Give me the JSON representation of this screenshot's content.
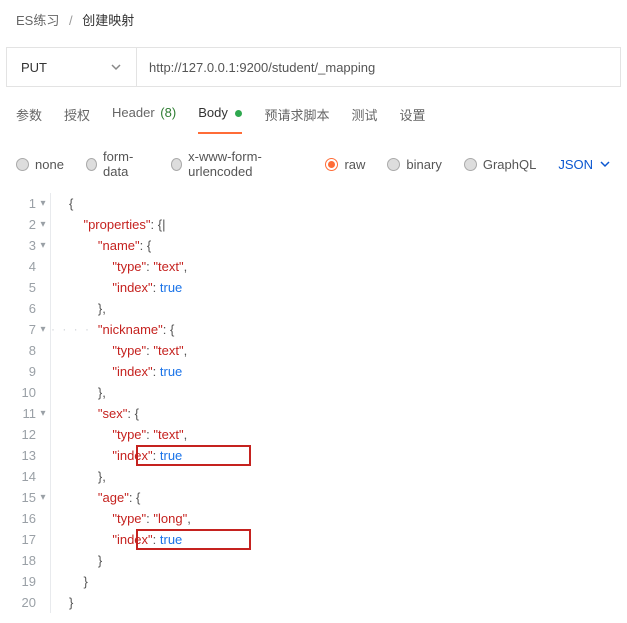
{
  "breadcrumb": {
    "root": "ES练习",
    "current": "创建映射"
  },
  "request": {
    "method": "PUT",
    "url": "http://127.0.0.1:9200/student/_mapping"
  },
  "tabs": {
    "params": "参数",
    "auth": "授权",
    "headers_label": "Header",
    "headers_count": "(8)",
    "body": "Body",
    "prescript": "预请求脚本",
    "tests": "测试",
    "settings": "设置"
  },
  "body_types": {
    "none": "none",
    "formdata": "form-data",
    "xform": "x-www-form-urlencoded",
    "raw": "raw",
    "binary": "binary",
    "graphql": "GraphQL",
    "format": "JSON"
  },
  "code": {
    "line1": "{",
    "k_properties": "\"properties\"",
    "k_name": "\"name\"",
    "k_nickname": "\"nickname\"",
    "k_sex": "\"sex\"",
    "k_age": "\"age\"",
    "k_type": "\"type\"",
    "k_index": "\"index\"",
    "v_text": "\"text\"",
    "v_long": "\"long\"",
    "v_true": "true",
    "brace_open": "{",
    "brace_close": "}",
    "brace_close_comma": "},",
    "colon_sp": ": ",
    "colon_obrace": ": {",
    "colon_obrace_bar": ": {|",
    "comma": ","
  },
  "line_numbers": [
    "1",
    "2",
    "3",
    "4",
    "5",
    "6",
    "7",
    "8",
    "9",
    "10",
    "11",
    "12",
    "13",
    "14",
    "15",
    "16",
    "17",
    "18",
    "19",
    "20"
  ]
}
